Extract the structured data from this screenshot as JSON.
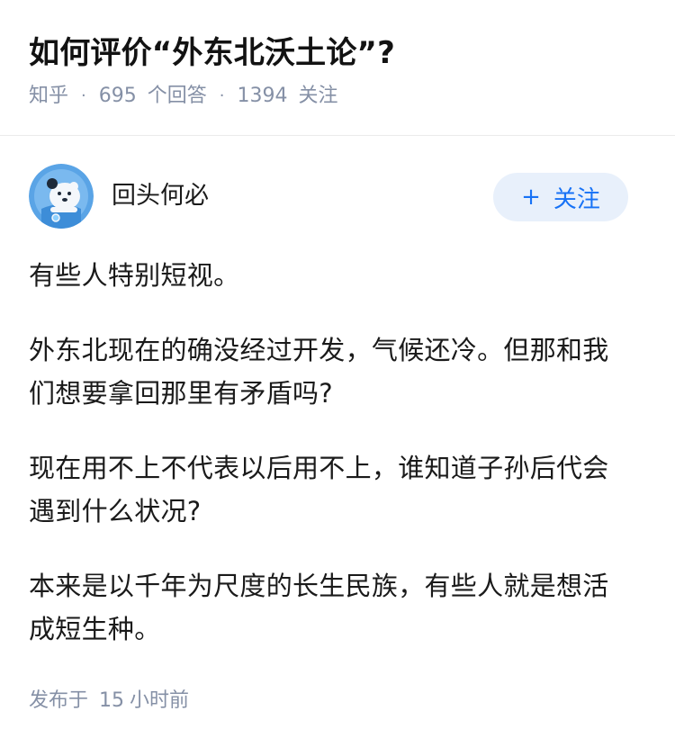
{
  "question": {
    "title": "如何评价“外东北沃土论”?",
    "source": "知乎",
    "answer_count": "695",
    "answer_label": "个回答",
    "follower_count": "1394",
    "follower_label": "关注",
    "separator": "·"
  },
  "answer": {
    "author_name": "回头何必",
    "follow_label": "关注",
    "follow_plus": "+",
    "paragraphs": [
      "有些人特别短视。",
      "外东北现在的确没经过开发，气候还冷。但那和我们想要拿回那里有矛盾吗?",
      "现在用不上不代表以后用不上，谁知道子孙后代会遇到什么状况?",
      "本来是以千年为尺度的长生民族，有些人就是想活成短生种。"
    ],
    "published_label": "发布于",
    "published_num": "15",
    "published_unit": "小时前"
  },
  "colors": {
    "accent": "#1772f6",
    "meta": "#8590a6",
    "follow_bg": "#e8f0fb",
    "avatar_bg": "#5aa4e6"
  },
  "icons": {
    "avatar": "cartoon-bear-avatar-icon"
  }
}
